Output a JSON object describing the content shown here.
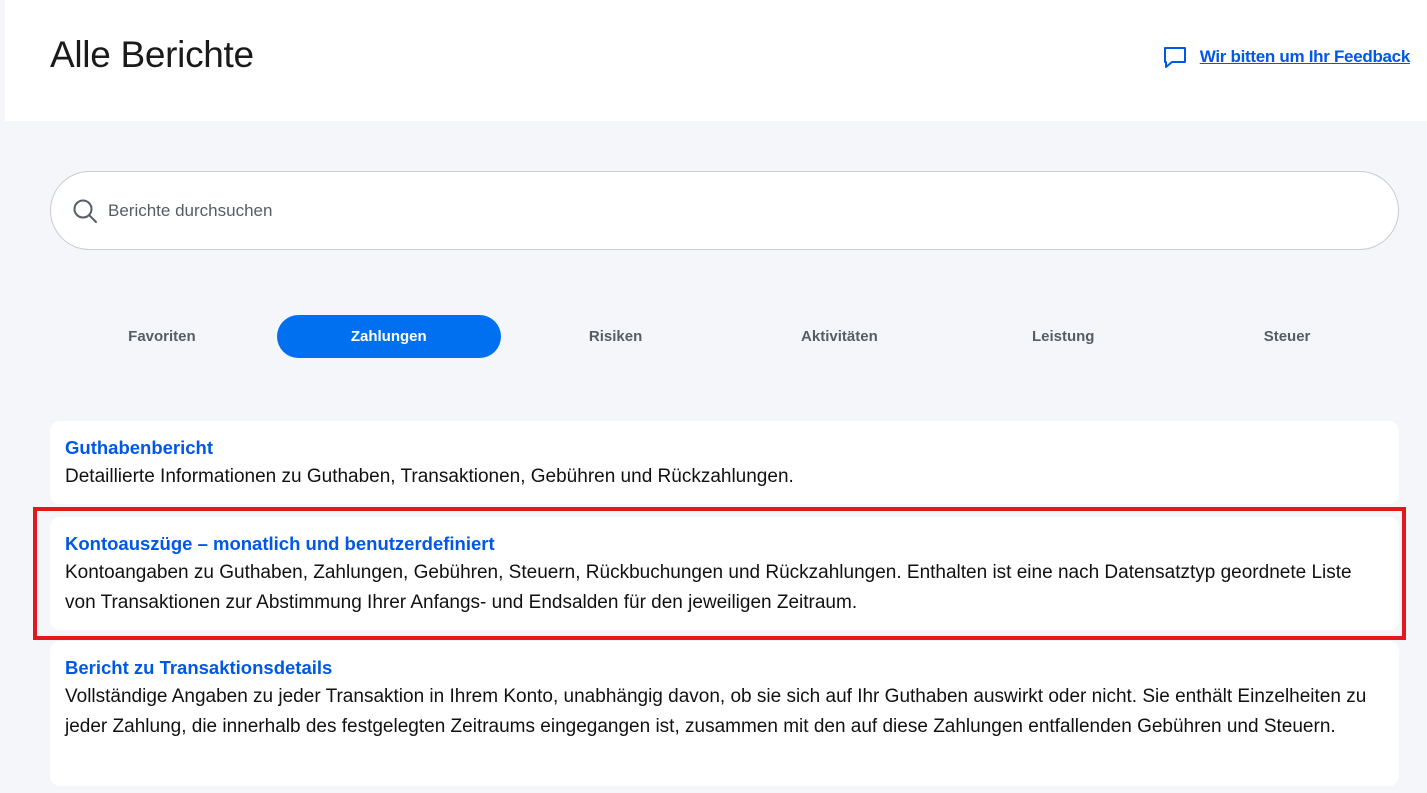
{
  "header": {
    "title": "Alle Berichte",
    "feedback_label": "Wir bitten um Ihr Feedback"
  },
  "search": {
    "placeholder": "Berichte durchsuchen"
  },
  "tabs": [
    {
      "label": "Favoriten"
    },
    {
      "label": "Zahlungen"
    },
    {
      "label": "Risiken"
    },
    {
      "label": "Aktivitäten"
    },
    {
      "label": "Leistung"
    },
    {
      "label": "Steuer"
    }
  ],
  "active_tab": "Zahlungen",
  "reports": [
    {
      "title": "Guthabenbericht",
      "description": "Detaillierte Informationen zu Guthaben, Transaktionen, Gebühren und Rückzahlungen."
    },
    {
      "title": "Kontoauszüge – monatlich und benutzerdefiniert",
      "description": "Kontoangaben zu Guthaben, Zahlungen, Gebühren, Steuern, Rückbuchungen und Rückzahlungen. Enthalten ist eine nach Datensatztyp geordnete Liste von Transaktionen zur Abstimmung Ihrer Anfangs- und Endsalden für den jeweiligen Zeitraum."
    },
    {
      "title": "Bericht zu Transaktionsdetails",
      "description": "Vollständige Angaben zu jeder Transaktion in Ihrem Konto, unabhängig davon, ob sie sich auf Ihr Guthaben auswirkt oder nicht. Sie enthält Einzelheiten zu jeder Zahlung, die innerhalb des festgelegten Zeitraums eingegangen ist, zusammen mit den auf diese Zahlungen entfallenden Gebühren und Steuern."
    }
  ],
  "icons": {
    "feedback": "speech-bubble-icon",
    "search": "search-icon"
  },
  "colors": {
    "accent": "#0070f0",
    "link": "#0058e5",
    "highlight": "#e3181f"
  }
}
